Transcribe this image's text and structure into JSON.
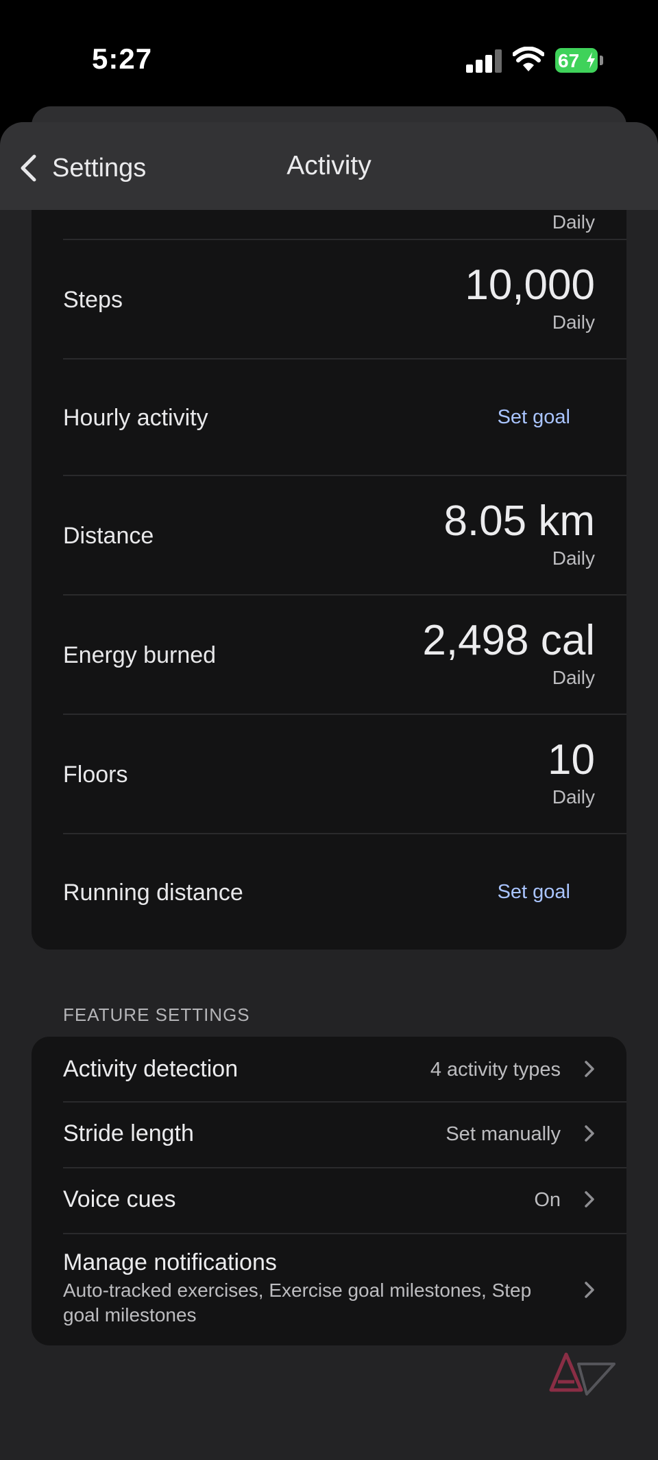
{
  "status_bar": {
    "time": "5:27",
    "battery": "67"
  },
  "nav": {
    "back_label": "Settings",
    "title": "Activity"
  },
  "goals": {
    "partial_top_label": "Daily",
    "rows": [
      {
        "name": "Steps",
        "value": "10,000",
        "period": "Daily"
      },
      {
        "name": "Hourly activity",
        "action": "Set goal"
      },
      {
        "name": "Distance",
        "value": "8.05 km",
        "period": "Daily"
      },
      {
        "name": "Energy burned",
        "value": "2,498 cal",
        "period": "Daily"
      },
      {
        "name": "Floors",
        "value": "10",
        "period": "Daily"
      },
      {
        "name": "Running distance",
        "action": "Set goal"
      }
    ]
  },
  "feature_settings": {
    "header": "FEATURE SETTINGS",
    "items": [
      {
        "name": "Activity detection",
        "value": "4 activity types"
      },
      {
        "name": "Stride length",
        "value": "Set manually"
      },
      {
        "name": "Voice cues",
        "value": "On"
      },
      {
        "name": "Manage notifications",
        "description": "Auto-tracked exercises, Exercise goal milestones, Step goal milestones"
      }
    ]
  },
  "colors": {
    "accent_link": "#a9c4ff",
    "battery": "#3fd25a",
    "card": "#131314",
    "sheet": "#232325"
  },
  "icons": [
    "chevron-left-icon",
    "chevron-right-icon",
    "signal-icon",
    "wifi-icon",
    "battery-icon",
    "android-police-logo"
  ]
}
